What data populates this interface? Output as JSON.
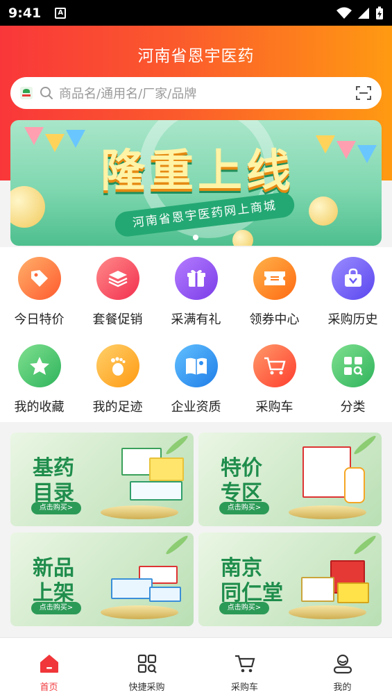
{
  "status_bar": {
    "time": "9:41"
  },
  "header": {
    "title": "河南省恩宇医药"
  },
  "search": {
    "placeholder": "商品名/通用名/厂家/品牌"
  },
  "banner": {
    "headline": "隆重上线",
    "ribbon": "河南省恩宇医药网上商城"
  },
  "quick_menu": [
    {
      "label": "今日特价",
      "icon": "price-tag-icon",
      "color": "#ff6a3d"
    },
    {
      "label": "套餐促销",
      "icon": "layers-icon",
      "color": "#f9425b"
    },
    {
      "label": "采满有礼",
      "icon": "gift-icon",
      "color": "#8a4df3"
    },
    {
      "label": "领券中心",
      "icon": "coupon-icon",
      "color": "#ff7a1a"
    },
    {
      "label": "采购历史",
      "icon": "shopping-bag-icon",
      "color": "#6a5cf5"
    },
    {
      "label": "我的收藏",
      "icon": "star-icon",
      "color": "#3fc46a"
    },
    {
      "label": "我的足迹",
      "icon": "footprint-icon",
      "color": "#ffa51e"
    },
    {
      "label": "企业资质",
      "icon": "certificate-book-icon",
      "color": "#2f8ff0"
    },
    {
      "label": "采购车",
      "icon": "cart-icon",
      "color": "#ff5a3a"
    },
    {
      "label": "分类",
      "icon": "category-icon",
      "color": "#3fbf6a"
    }
  ],
  "promo_cards": [
    {
      "line1": "基药",
      "line2": "目录",
      "button": "点击购买>"
    },
    {
      "line1": "特价",
      "line2": "专区",
      "button": "点击购买>"
    },
    {
      "line1": "新品",
      "line2": "上架",
      "button": "点击购买>"
    },
    {
      "line1": "南京",
      "line2": "同仁堂",
      "button": "点击购买>"
    }
  ],
  "tab_bar": [
    {
      "label": "首页",
      "icon": "home-icon",
      "active": true
    },
    {
      "label": "快捷采购",
      "icon": "quick-purchase-icon",
      "active": false
    },
    {
      "label": "采购车",
      "icon": "cart-icon",
      "active": false
    },
    {
      "label": "我的",
      "icon": "profile-icon",
      "active": false
    }
  ],
  "colors": {
    "primary": "#f0363a",
    "accent": "#ff9a12"
  }
}
